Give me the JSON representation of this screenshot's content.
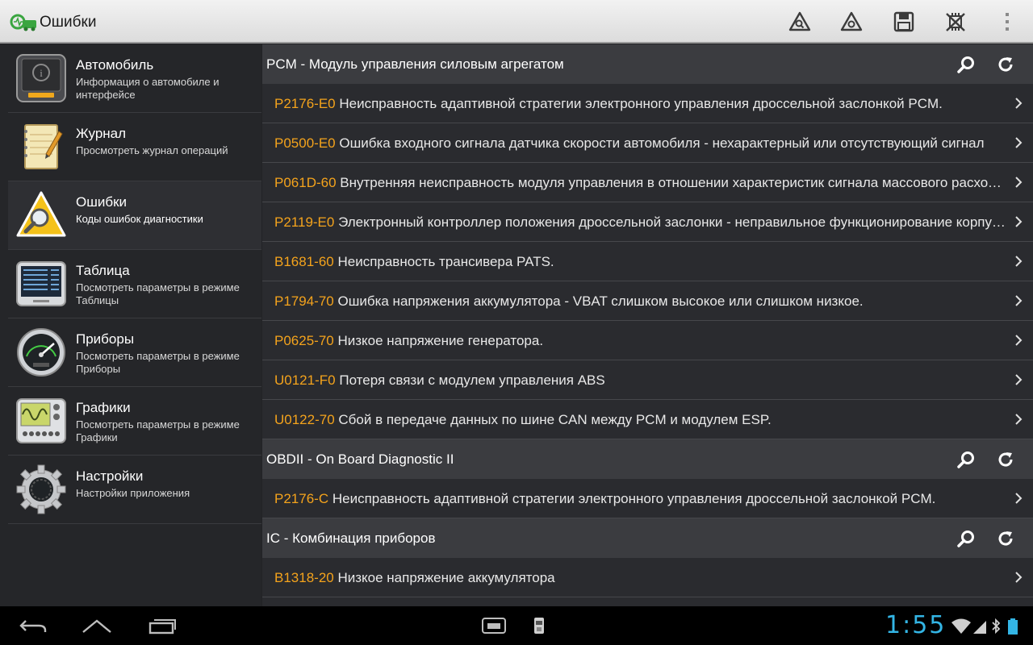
{
  "actionbar": {
    "title": "Ошибки",
    "buttons": [
      {
        "icon": "warning-scan-icon"
      },
      {
        "icon": "warning-clear-icon"
      },
      {
        "icon": "save-icon"
      },
      {
        "icon": "disconnect-icon"
      },
      {
        "icon": "overflow-menu-icon"
      }
    ]
  },
  "nav": {
    "items": [
      {
        "title": "Автомобиль",
        "subtitle": "Информация о автомобиле и интерфейсе",
        "icon": "car-info-icon"
      },
      {
        "title": "Журнал",
        "subtitle": "Просмотреть журнал операций",
        "icon": "journal-icon"
      },
      {
        "title": "Ошибки",
        "subtitle": "Коды ошибок диагностики",
        "icon": "warning-magnifier-icon",
        "selected": true
      },
      {
        "title": "Таблица",
        "subtitle": "Посмотреть параметры в режиме Таблицы",
        "icon": "table-display-icon"
      },
      {
        "title": "Приборы",
        "subtitle": "Посмотреть параметры в режиме Приборы",
        "icon": "gauge-icon"
      },
      {
        "title": "Графики",
        "subtitle": "Посмотреть параметры в режиме Графики",
        "icon": "oscilloscope-icon"
      },
      {
        "title": "Настройки",
        "subtitle": "Настройки приложения",
        "icon": "gear-icon"
      }
    ]
  },
  "sections": [
    {
      "title": "PCM - Модуль управления силовым агрегатом",
      "rows": [
        {
          "code": "P2176-E0",
          "text": "Неисправность адаптивной стратегии электронного управления дроссельной заслонкой PCM."
        },
        {
          "code": "P0500-E0",
          "text": "Ошибка входного сигнала датчика скорости автомобиля - нехарактерный или отсутствующий сигнал"
        },
        {
          "code": "P061D-60",
          "text": "Внутренняя неисправность модуля управления в отношении характеристик сигнала массового расхода воздуха"
        },
        {
          "code": "P2119-E0",
          "text": "Электронный контроллер положения дроссельной заслонки - неправильное функционирование корпуса дроссельной заслонки"
        },
        {
          "code": "B1681-60",
          "text": "Неисправность трансивера PATS."
        },
        {
          "code": "P1794-70",
          "text": "Ошибка напряжения аккумулятора - VBAT слишком высокое или слишком низкое."
        },
        {
          "code": "P0625-70",
          "text": "Низкое напряжение генератора."
        },
        {
          "code": "U0121-F0",
          "text": "Потеря связи с модулем управления ABS"
        },
        {
          "code": "U0122-70",
          "text": "Сбой в передаче данных по шине CAN между PCM и модулем ESP."
        }
      ]
    },
    {
      "title": "OBDII - On Board Diagnostic II",
      "rows": [
        {
          "code": "P2176-C",
          "text": "Неисправность адаптивной стратегии электронного управления дроссельной заслонкой PCM."
        }
      ]
    },
    {
      "title": "IC - Комбинация приборов",
      "rows": [
        {
          "code": "B1318-20",
          "text": "Низкое напряжение аккумулятора"
        }
      ]
    }
  ],
  "statusbar": {
    "clock": "1:55"
  },
  "colors": {
    "accent_code": "#f4a31c",
    "clock": "#33b5e5",
    "background": "#2a2b2f"
  }
}
